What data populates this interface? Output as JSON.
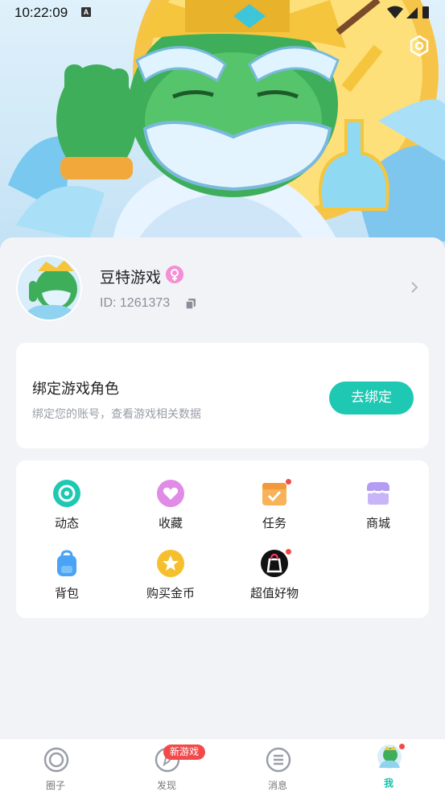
{
  "status_bar": {
    "time": "10:22:09",
    "notification_letter": "A"
  },
  "profile": {
    "username": "豆特游戏",
    "user_id": "ID: 1261373"
  },
  "bind_card": {
    "title": "绑定游戏角色",
    "subtitle": "绑定您的账号，查看游戏相关数据",
    "button_label": "去绑定"
  },
  "features": [
    {
      "label": "动态",
      "icon": "feed-icon",
      "color": "#1ec8b3"
    },
    {
      "label": "收藏",
      "icon": "heart-icon",
      "color": "#e08be6"
    },
    {
      "label": "任务",
      "icon": "calendar-check-icon",
      "color": "#f7b25a",
      "badge": true
    },
    {
      "label": "商城",
      "icon": "store-icon",
      "color": "#b39cf2"
    },
    {
      "label": "背包",
      "icon": "backpack-icon",
      "color": "#4aa3f5"
    },
    {
      "label": "购买金币",
      "icon": "coin-star-icon",
      "color": "#f5bf2e"
    },
    {
      "label": "超值好物",
      "icon": "shopping-bag-icon",
      "color": "#111111",
      "badge": true
    }
  ],
  "tabbar": {
    "tabs": [
      {
        "label": "圈子",
        "icon": "circle-icon"
      },
      {
        "label": "发现",
        "icon": "compass-icon",
        "badge": "新游戏"
      },
      {
        "label": "消息",
        "icon": "message-icon"
      },
      {
        "label": "我",
        "icon": "avatar-icon",
        "active": true
      }
    ]
  },
  "colors": {
    "accent": "#1ec8b3",
    "badge_red": "#f24a4a"
  }
}
